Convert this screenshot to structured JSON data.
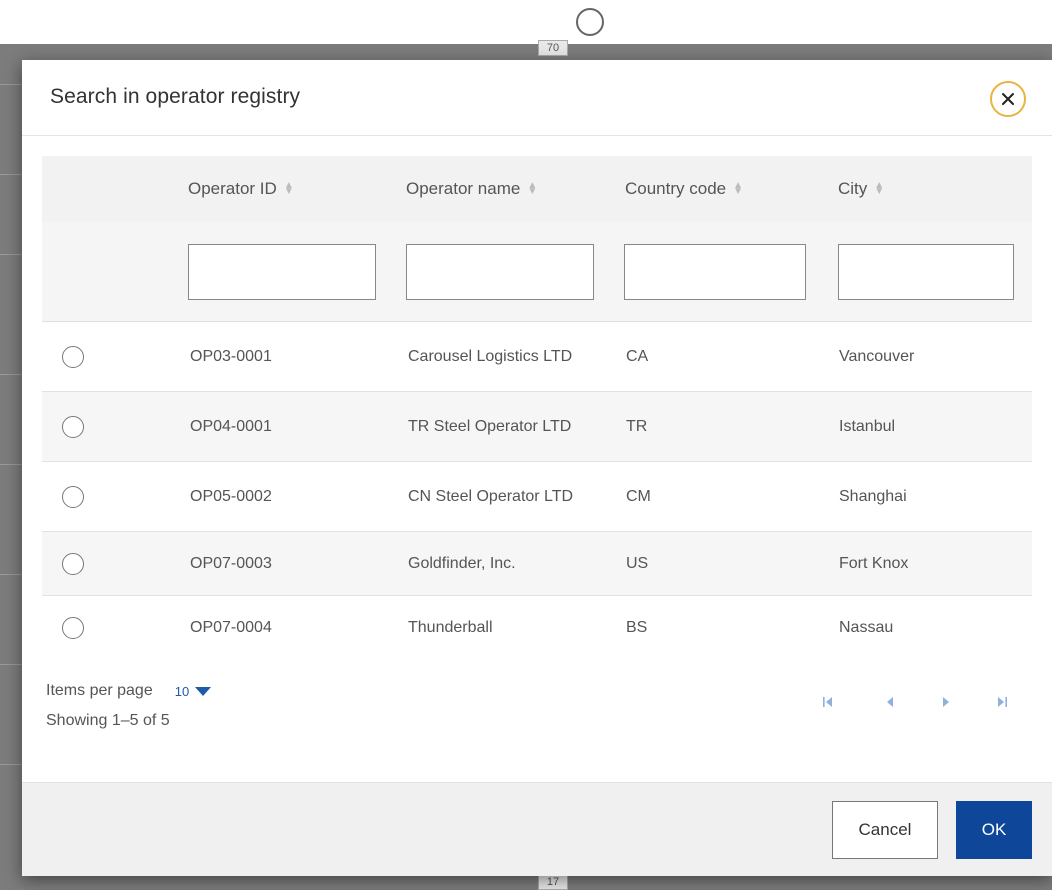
{
  "backdrop": {
    "tab_top": "70",
    "tab_bottom": "17"
  },
  "dialog": {
    "title": "Search in operator registry",
    "close_icon": "close-icon"
  },
  "table": {
    "columns": [
      {
        "label": "Operator ID",
        "sortable": true
      },
      {
        "label": "Operator name",
        "sortable": true
      },
      {
        "label": "Country code",
        "sortable": true
      },
      {
        "label": "City",
        "sortable": true
      }
    ],
    "filters": [
      {
        "value": "",
        "placeholder": ""
      },
      {
        "value": "",
        "placeholder": ""
      },
      {
        "value": "",
        "placeholder": ""
      },
      {
        "value": "",
        "placeholder": ""
      }
    ],
    "rows": [
      {
        "operator_id": "OP03-0001",
        "operator_name": "Carousel Logistics LTD",
        "country_code": "CA",
        "city": "Vancouver"
      },
      {
        "operator_id": "OP04-0001",
        "operator_name": "TR Steel Operator LTD",
        "country_code": "TR",
        "city": "Istanbul"
      },
      {
        "operator_id": "OP05-0002",
        "operator_name": "CN Steel Operator LTD",
        "country_code": "CM",
        "city": "Shanghai"
      },
      {
        "operator_id": "OP07-0003",
        "operator_name": "Goldfinder, Inc.",
        "country_code": "US",
        "city": "Fort Knox"
      },
      {
        "operator_id": "OP07-0004",
        "operator_name": "Thunderball",
        "country_code": "BS",
        "city": "Nassau"
      }
    ]
  },
  "pagination": {
    "items_per_page_label": "Items per page",
    "items_per_page_value": "10",
    "showing": "Showing 1–5 of 5"
  },
  "footer": {
    "cancel_label": "Cancel",
    "ok_label": "OK"
  },
  "colors": {
    "primary": "#0e4699",
    "close_ring": "#e9b43d",
    "link": "#1f5aa6",
    "pager_icon": "#8fb1dc"
  }
}
